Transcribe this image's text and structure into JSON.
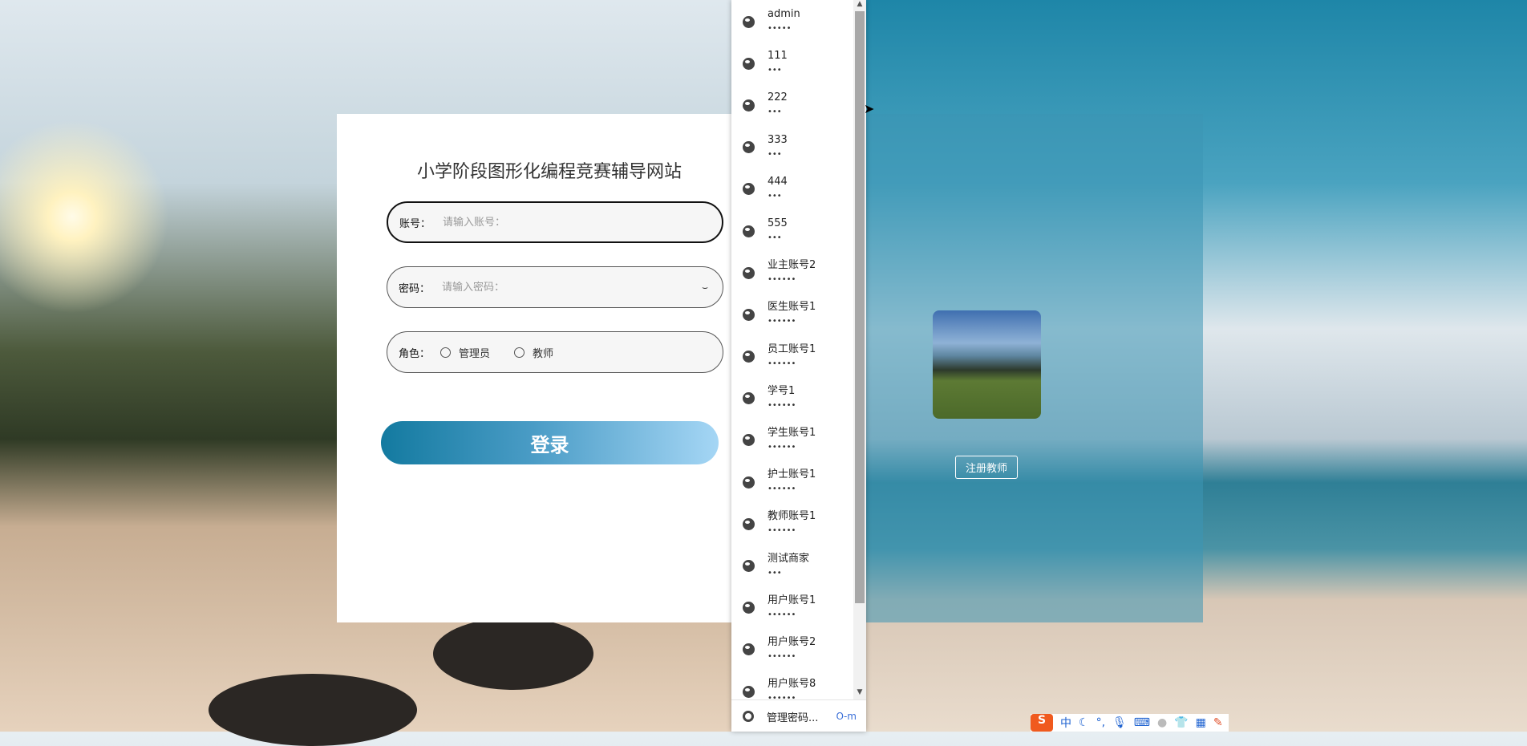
{
  "login": {
    "title": "小学阶段图形化编程竞赛辅导网站",
    "account_label": "账号：",
    "account_placeholder": "请输入账号：",
    "password_label": "密码：",
    "password_placeholder": "请输入密码：",
    "role_label": "角色：",
    "roles": [
      "管理员",
      "教师"
    ],
    "submit_label": "登录",
    "button_gradient": [
      "#137aa0",
      "#a5d6f5"
    ]
  },
  "side_panel": {
    "register_label": "注册教师"
  },
  "autofill": {
    "items": [
      {
        "user": "admin",
        "pw": "•••••"
      },
      {
        "user": "111",
        "pw": "•••"
      },
      {
        "user": "222",
        "pw": "•••"
      },
      {
        "user": "333",
        "pw": "•••"
      },
      {
        "user": "444",
        "pw": "•••"
      },
      {
        "user": "555",
        "pw": "•••"
      },
      {
        "user": "业主账号2",
        "pw": "••••••"
      },
      {
        "user": "医生账号1",
        "pw": "••••••"
      },
      {
        "user": "员工账号1",
        "pw": "••••••"
      },
      {
        "user": "学号1",
        "pw": "••••••"
      },
      {
        "user": "学生账号1",
        "pw": "••••••"
      },
      {
        "user": "护士账号1",
        "pw": "••••••"
      },
      {
        "user": "教师账号1",
        "pw": "••••••"
      },
      {
        "user": "测试商家",
        "pw": "•••"
      },
      {
        "user": "用户账号1",
        "pw": "••••••"
      },
      {
        "user": "用户账号2",
        "pw": "••••••"
      },
      {
        "user": "用户账号8",
        "pw": "••••••"
      }
    ],
    "manage_label": "管理密码..."
  },
  "ime": {
    "logo": "S",
    "mode": "中",
    "icons": [
      "moon-icon",
      "punctuation-icon",
      "microphone-icon",
      "keyboard-icon",
      "user-icon",
      "skin-icon",
      "apps-icon",
      "tools-icon"
    ]
  }
}
